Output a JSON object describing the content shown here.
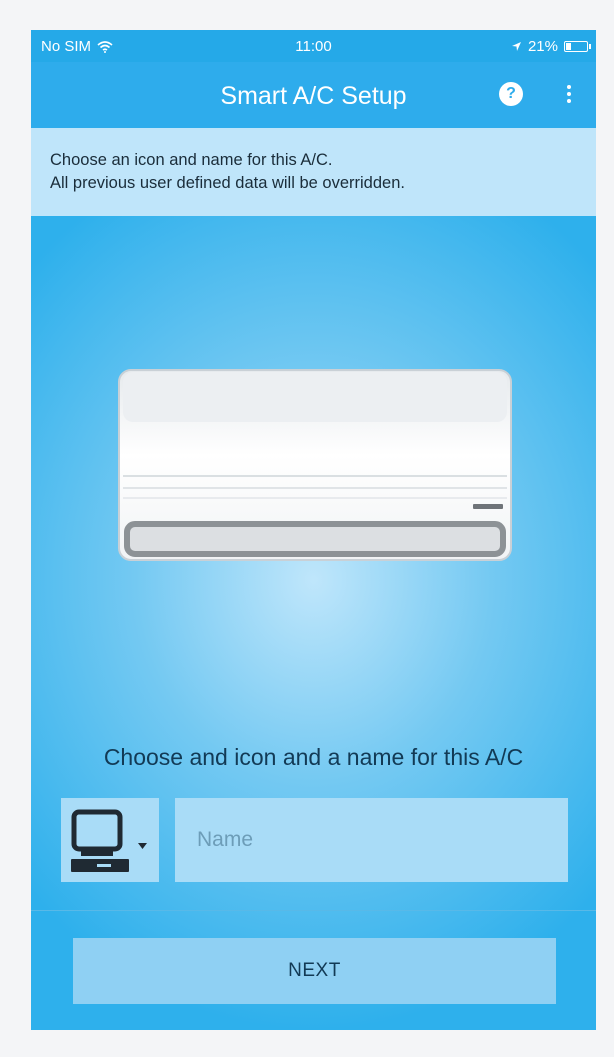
{
  "status_bar": {
    "carrier": "No SIM",
    "time": "11:00",
    "battery": "21%"
  },
  "app_bar": {
    "title": "Smart A/C Setup",
    "help_glyph": "?"
  },
  "banner": {
    "line1": "Choose an icon and name for this A/C.",
    "line2": "All previous user defined data will be overridden."
  },
  "main": {
    "prompt": "Choose and icon and a name for this A/C",
    "name_input": {
      "value": "",
      "placeholder": "Name"
    },
    "selected_icon": "computer-icon"
  },
  "footer": {
    "next_label": "NEXT"
  },
  "colors": {
    "status_bar": "#25a9e8",
    "app_bar": "#2eacec",
    "banner": "#bfe5fa",
    "input_background": "#a9dcf7",
    "button_background": "#8fd0f3"
  }
}
